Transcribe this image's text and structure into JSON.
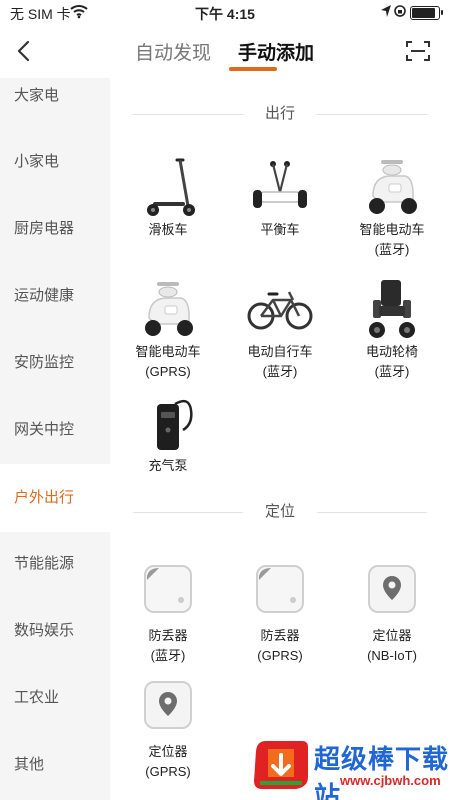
{
  "status_bar": {
    "carrier": "无 SIM 卡",
    "time": "下午 4:15",
    "battery_level": 0.9
  },
  "header": {
    "tabs": [
      {
        "label": "自动发现",
        "selected": false
      },
      {
        "label": "手动添加",
        "selected": true
      }
    ],
    "accent_color": "#e06a1b"
  },
  "sidebar": {
    "items": [
      {
        "label": "大家电"
      },
      {
        "label": "小家电"
      },
      {
        "label": "厨房电器"
      },
      {
        "label": "运动健康"
      },
      {
        "label": "安防监控"
      },
      {
        "label": "网关中控"
      },
      {
        "label": "户外出行",
        "selected": true
      },
      {
        "label": "节能能源"
      },
      {
        "label": "数码娱乐"
      },
      {
        "label": "工农业"
      },
      {
        "label": "其他"
      }
    ]
  },
  "sections": [
    {
      "title": "出行",
      "items": [
        {
          "line1": "滑板车",
          "line2": "",
          "icon": "scooter-icon"
        },
        {
          "line1": "平衡车",
          "line2": "",
          "icon": "balance-scooter-icon"
        },
        {
          "line1": "智能电动车",
          "line2": "(蓝牙)",
          "icon": "e-bike-icon"
        },
        {
          "line1": "智能电动车",
          "line2": "(GPRS)",
          "icon": "e-bike-icon"
        },
        {
          "line1": "电动自行车",
          "line2": "(蓝牙)",
          "icon": "bicycle-icon"
        },
        {
          "line1": "电动轮椅",
          "line2": "(蓝牙)",
          "icon": "wheelchair-icon"
        },
        {
          "line1": "充气泵",
          "line2": "",
          "icon": "air-pump-icon"
        }
      ]
    },
    {
      "title": "定位",
      "items": [
        {
          "line1": "防丢器",
          "line2": "(蓝牙)",
          "icon": "tracker-tag-icon"
        },
        {
          "line1": "防丢器",
          "line2": "(GPRS)",
          "icon": "tracker-tag-icon"
        },
        {
          "line1": "定位器",
          "line2": "(NB-IoT)",
          "icon": "location-pin-icon"
        },
        {
          "line1": "定位器",
          "line2": "(GPRS)",
          "icon": "location-pin-icon"
        }
      ]
    }
  ],
  "watermark": {
    "title": "超级棒下载站",
    "url": "www.cjbwh.com"
  }
}
